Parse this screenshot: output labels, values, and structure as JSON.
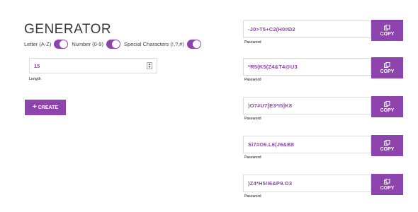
{
  "title": "GENERATOR",
  "options": [
    {
      "label": "Letter (A-Z)",
      "enabled": true
    },
    {
      "label": "Number (0-9)",
      "enabled": true
    },
    {
      "label": "Special Characters (!,?,#)",
      "enabled": true
    }
  ],
  "length": {
    "value": "15",
    "label": "Length"
  },
  "create_label": "CREATE",
  "create_icon": "plus-icon",
  "copy_icon": "copy-icon",
  "accent_color": "#8e44ad",
  "passwords": [
    {
      "value": "-J0>T5+C2(H0#D2",
      "label": "Password",
      "copy_label": "COPY"
    },
    {
      "value": "*R5(K5(Z4&T4@U3",
      "label": "Password",
      "copy_label": "COPY"
    },
    {
      "value": ")O7#U7[E3*I5]K8",
      "label": "Password",
      "copy_label": "COPY"
    },
    {
      "value": "Si7#O6.L6(J6&B8",
      "label": "Password",
      "copy_label": "COPY"
    },
    {
      "value": ")Z4*H5!I6&P9.O3",
      "label": "Password",
      "copy_label": "COPY"
    }
  ]
}
